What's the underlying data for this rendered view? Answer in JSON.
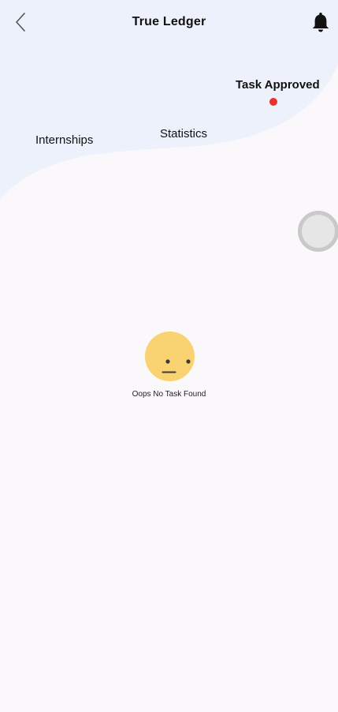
{
  "header": {
    "title": "True Ledger",
    "back_icon": "chevron-left-icon",
    "notification_icon": "bell-icon"
  },
  "tabs": [
    {
      "label": "Internships",
      "active": false
    },
    {
      "label": "Statistics",
      "active": false
    },
    {
      "label": "Task Approved",
      "active": true
    }
  ],
  "empty_state": {
    "icon": "neutral-face-icon",
    "message": "Oops No Task Found"
  },
  "colors": {
    "background": "#faf8fb",
    "header_wave": "#edf1fb",
    "active_indicator": "#e8332a",
    "face": "#f9d272",
    "toggle_ring": "#c9c9c9",
    "toggle_fill": "#e6e6e6"
  }
}
